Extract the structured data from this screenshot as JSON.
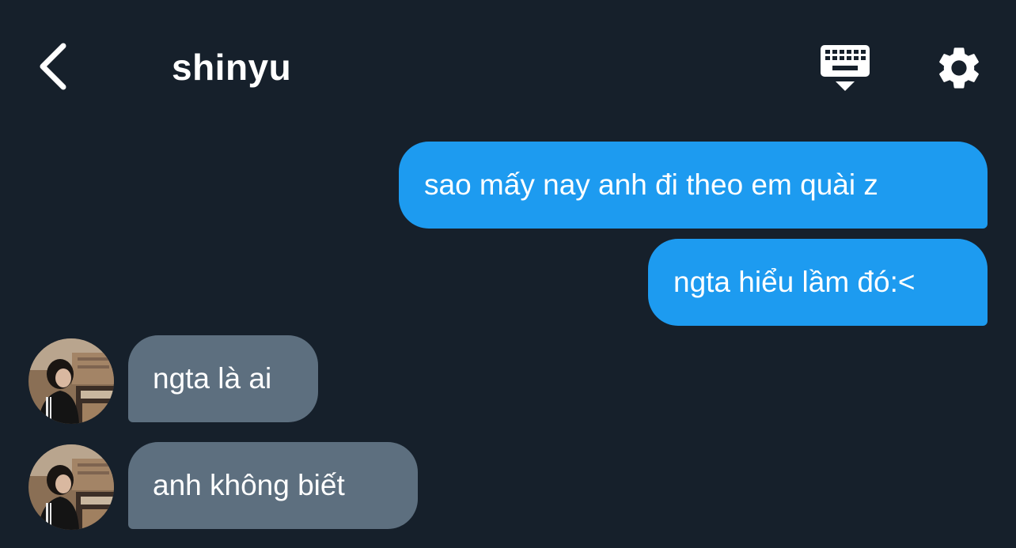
{
  "header": {
    "title": "shinyu",
    "back_icon": "chevron-left-icon",
    "keyboard_icon": "keyboard-icon",
    "settings_icon": "gear-icon"
  },
  "colors": {
    "background": "#16202b",
    "outgoing_bubble": "#1d9bf0",
    "incoming_bubble": "#5d6f7f",
    "text": "#ffffff"
  },
  "messages": [
    {
      "direction": "outgoing",
      "text": "sao mấy nay anh đi theo em quài z"
    },
    {
      "direction": "outgoing",
      "text": "ngta hiểu lầm đó:<"
    },
    {
      "direction": "incoming",
      "text": "ngta là ai"
    },
    {
      "direction": "incoming",
      "text": "anh không biết"
    }
  ]
}
